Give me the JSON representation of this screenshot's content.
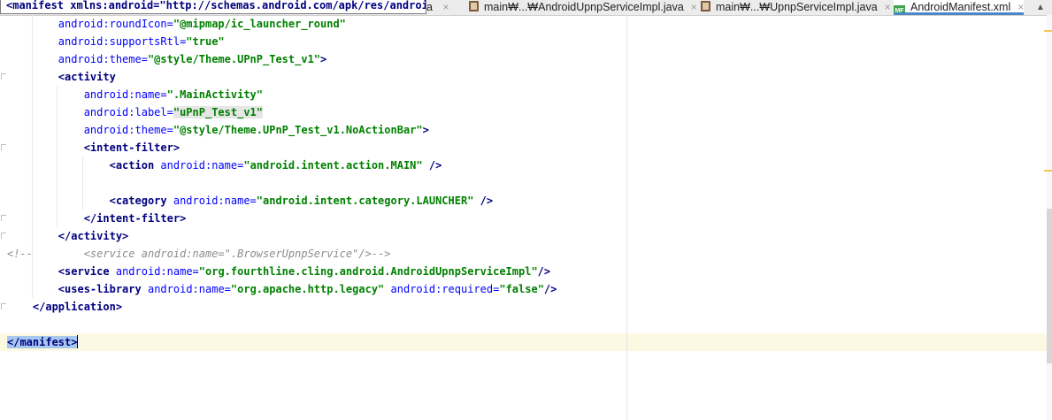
{
  "tabs": {
    "overlay_text": "<manifest xmlns:android=\"http://schemas.android.com/apk/res/android\"",
    "partial_tab_suffix": "a",
    "items": [
      {
        "label": "main₩...₩AndroidUpnpServiceImpl.java",
        "close": "×"
      },
      {
        "label": "main₩...₩UpnpServiceImpl.java",
        "close": "×"
      },
      {
        "label": "AndroidManifest.xml",
        "close": "×",
        "active": true,
        "icon_text": "MF"
      }
    ],
    "scroll_up": "▲"
  },
  "code": {
    "l1_attr": "android:roundIcon=",
    "l1_val": "\"@mipmap/ic_launcher_round\"",
    "l2_attr": "android:supportsRtl=",
    "l2_val": "\"true\"",
    "l3_attr": "android:theme=",
    "l3_val": "\"@style/Theme.UPnP_Test_v1\"",
    "l3_end": ">",
    "l4_lt": "<",
    "l4_tag": "activity",
    "l5_attr": "android:name=",
    "l5_val": "\".MainActivity\"",
    "l6_attr": "android:label=",
    "l6_val": "\"uPnP_Test_v1\"",
    "l7_attr": "android:theme=",
    "l7_val": "\"@style/Theme.UPnP_Test_v1.NoActionBar\"",
    "l7_end": ">",
    "l8_lt": "<",
    "l8_tag": "intent-filter",
    "l8_gt": ">",
    "l9_lt": "<",
    "l9_tag": "action",
    "l9_attr": "android:name=",
    "l9_val": "\"android.intent.action.MAIN\"",
    "l9_end": " />",
    "l11_lt": "<",
    "l11_tag": "category",
    "l11_attr": "android:name=",
    "l11_val": "\"android.intent.category.LAUNCHER\"",
    "l11_end": " />",
    "l12_open": "</",
    "l12_tag": "intent-filter",
    "l12_gt": ">",
    "l13_open": "</",
    "l13_tag": "activity",
    "l13_gt": ">",
    "l14_comment_start": "<!--",
    "l14_comment_body": "<service android:name=\".BrowserUpnpService\"/>-->",
    "l15_lt": "<",
    "l15_tag": "service",
    "l15_attr": "android:name=",
    "l15_val": "\"org.fourthline.cling.android.AndroidUpnpServiceImpl\"",
    "l15_end": "/>",
    "l16_lt": "<",
    "l16_tag": "uses-library",
    "l16_attr": "android:name=",
    "l16_val": "\"org.apache.http.legacy\"",
    "l16_attr2": "android:required=",
    "l16_val2": "\"false\"",
    "l16_end": "/>",
    "l17_open": "</",
    "l17_tag": "application",
    "l17_gt": ">",
    "l19_text": "</manifest>"
  },
  "colors": {
    "tag": "#000080",
    "attribute": "#0000ff",
    "value": "#008000",
    "comment": "#8c8c8c",
    "tab_accent": "#4a88c7",
    "marker": "#f2c55c"
  }
}
